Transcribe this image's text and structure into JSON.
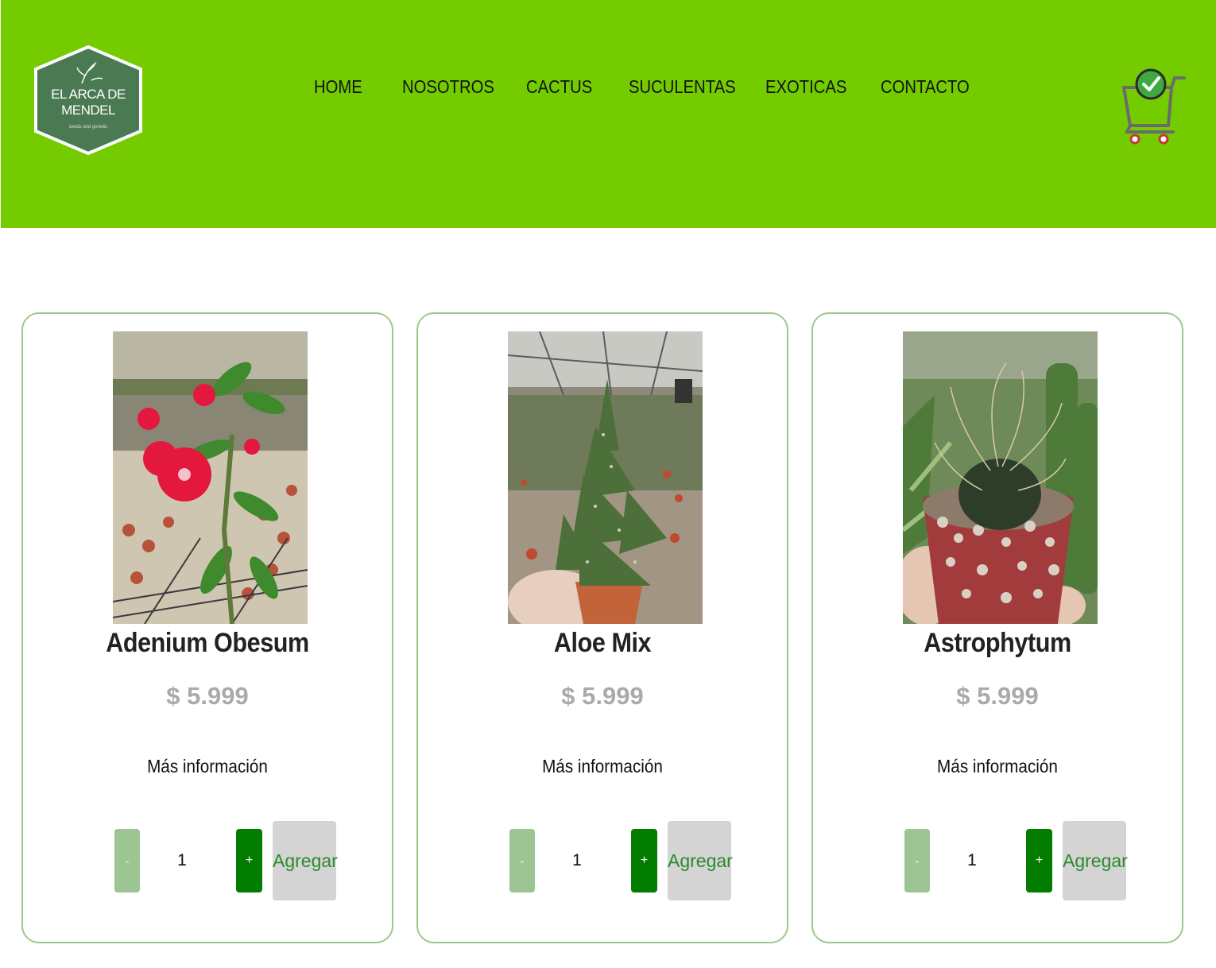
{
  "brand": {
    "logo_line1": "EL ARCA DE",
    "logo_line2": "MENDEL",
    "logo_tagline": "seeds and genetic",
    "header_color": "#74cc00"
  },
  "nav": {
    "items": [
      {
        "label": "HOME"
      },
      {
        "label": "NOSOTROS"
      },
      {
        "label": "CACTUS"
      },
      {
        "label": "SUCULENTAS"
      },
      {
        "label": "EXOTICAS"
      },
      {
        "label": "CONTACTO"
      }
    ]
  },
  "cart": {
    "icon": "shopping-cart-check-icon"
  },
  "products": [
    {
      "name": "Adenium Obesum",
      "price": "$ 5.999",
      "more": "Más información",
      "minus": "-",
      "qty": "1",
      "plus": "+",
      "add": "Agregar",
      "photo": "red-flower-plant-photo"
    },
    {
      "name": "Aloe Mix",
      "price": "$ 5.999",
      "more": "Más información",
      "minus": "-",
      "qty": "1",
      "plus": "+",
      "add": "Agregar",
      "photo": "aloe-pot-photo"
    },
    {
      "name": "Astrophytum",
      "price": "$ 5.999",
      "more": "Más información",
      "minus": "-",
      "qty": "1",
      "plus": "+",
      "add": "Agregar",
      "photo": "cactus-pot-photo"
    }
  ],
  "colors": {
    "card_border": "#9cc98a",
    "price": "#aaaaaa",
    "minus_btn": "#9cc593",
    "plus_btn": "#037d00",
    "add_btn_bg": "#d4d4d4",
    "add_btn_text": "#2b8a2b"
  }
}
